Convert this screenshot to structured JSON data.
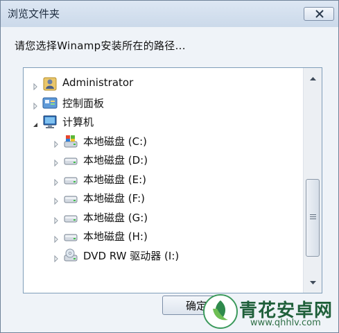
{
  "window": {
    "title": "浏览文件夹"
  },
  "prompt": "请您选择Winamp安装所在的路径...",
  "tree": {
    "items": [
      {
        "label": "Administrator",
        "icon": "user-folder-icon",
        "expanded": false,
        "indent": 0
      },
      {
        "label": "控制面板",
        "icon": "control-panel-icon",
        "expanded": false,
        "indent": 0
      },
      {
        "label": "计算机",
        "icon": "computer-icon",
        "expanded": true,
        "indent": 0
      },
      {
        "label": "本地磁盘 (C:)",
        "icon": "system-drive-icon",
        "expanded": false,
        "indent": 1
      },
      {
        "label": "本地磁盘 (D:)",
        "icon": "hard-drive-icon",
        "expanded": false,
        "indent": 1
      },
      {
        "label": "本地磁盘 (E:)",
        "icon": "hard-drive-icon",
        "expanded": false,
        "indent": 1
      },
      {
        "label": "本地磁盘 (F:)",
        "icon": "hard-drive-icon",
        "expanded": false,
        "indent": 1
      },
      {
        "label": "本地磁盘 (G:)",
        "icon": "hard-drive-icon",
        "expanded": false,
        "indent": 1
      },
      {
        "label": "本地磁盘 (H:)",
        "icon": "hard-drive-icon",
        "expanded": false,
        "indent": 1
      },
      {
        "label": "DVD RW 驱动器 (I:)",
        "icon": "dvd-drive-icon",
        "expanded": false,
        "indent": 1
      }
    ]
  },
  "buttons": {
    "ok_label": "确定"
  },
  "watermark": {
    "text": "青花安卓网",
    "url": "www.qhhlv.com"
  },
  "colors": {
    "title_bar": "#cbd9ea",
    "tree_border": "#7f9db9",
    "watermark": "#1f5f3a"
  }
}
